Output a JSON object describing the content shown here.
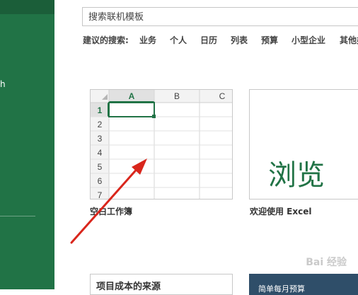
{
  "sidebar": {
    "label_fragment": "h"
  },
  "search": {
    "placeholder": "搜索联机模板"
  },
  "suggestions": {
    "label": "建议的搜索:",
    "items": [
      "业务",
      "个人",
      "日历",
      "列表",
      "预算",
      "小型企业",
      "其他类"
    ]
  },
  "templates": {
    "blank": {
      "caption": "空白工作簿",
      "columns": [
        "A",
        "B",
        "C"
      ],
      "rows": [
        "1",
        "2",
        "3",
        "4",
        "5",
        "6",
        "7"
      ]
    },
    "tour": {
      "caption": "欢迎使用 Excel",
      "preview_text": "浏览"
    },
    "project": {
      "title": "项目成本的来源"
    },
    "budget": {
      "title": "简单每月预算"
    }
  },
  "watermark": "Bai 经验",
  "colors": {
    "sidebar": "#217346",
    "accent": "#217346",
    "arrow": "#d9261c"
  }
}
